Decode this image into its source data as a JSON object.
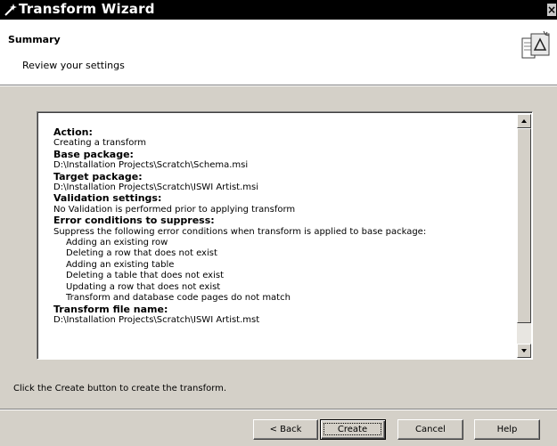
{
  "window": {
    "title": "Transform Wizard",
    "title_icon": "wizard-wand-icon",
    "close_glyph": "×"
  },
  "header": {
    "title": "Summary",
    "subtitle": "Review your settings",
    "icon": "transform-document-icon"
  },
  "summary": {
    "action_label": "Action:",
    "action_value": "Creating a transform",
    "base_label": "Base package:",
    "base_value": "D:\\Installation Projects\\Scratch\\Schema.msi",
    "target_label": "Target package:",
    "target_value": "D:\\Installation Projects\\Scratch\\ISWI Artist.msi",
    "validation_label": "Validation settings:",
    "validation_value": "No Validation is performed prior to applying transform",
    "errors_label": "Error conditions to suppress:",
    "errors_intro": "Suppress the following error conditions when transform is applied to base package:",
    "errors": [
      "Adding an existing row",
      "Deleting a row that does not exist",
      "Adding an existing table",
      "Deleting a table that does not exist",
      "Updating a row that does not exist",
      "Transform and database code pages do not match"
    ],
    "file_label": "Transform file name:",
    "file_value": "D:\\Installation Projects\\Scratch\\ISWI Artist.mst"
  },
  "instruction": "Click the Create button to create the transform.",
  "buttons": {
    "back": "< Back",
    "create": "Create",
    "cancel": "Cancel",
    "help": "Help"
  }
}
